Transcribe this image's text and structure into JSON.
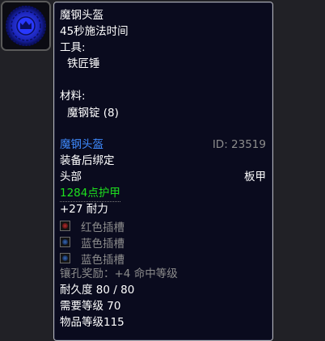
{
  "item_icon": {
    "name": "helm-rune-icon",
    "colors": {
      "ring": "#1a2fe0",
      "center": "#2838ff",
      "frame": "#5a5a5a"
    }
  },
  "recipe": {
    "name": "魔钢头盔",
    "cast_time": "45秒施法时间",
    "tools_label": "工具:",
    "tool": "铁匠锤",
    "materials_label": "材料:",
    "material": "魔钢锭 (8)"
  },
  "item": {
    "name": "魔钢头盔",
    "id_text": "ID: 23519",
    "bind": "装备后绑定",
    "slot": "头部",
    "armor_type": "板甲",
    "armor": "1284点护甲",
    "stamina": "+27 耐力",
    "sockets": [
      {
        "color": "red",
        "label": "红色插槽"
      },
      {
        "color": "blue",
        "label": "蓝色插槽"
      },
      {
        "color": "blue",
        "label": "蓝色插槽"
      }
    ],
    "socket_bonus": "镶孔奖励：+4 命中等级",
    "durability": "耐久度 80 / 80",
    "required_level": "需要等级 70",
    "item_level": "物品等级115"
  },
  "colors": {
    "item_name": "#3f8bff",
    "armor": "#1ee01e",
    "muted": "#8c8c8c",
    "background": "#0a0b1e"
  }
}
